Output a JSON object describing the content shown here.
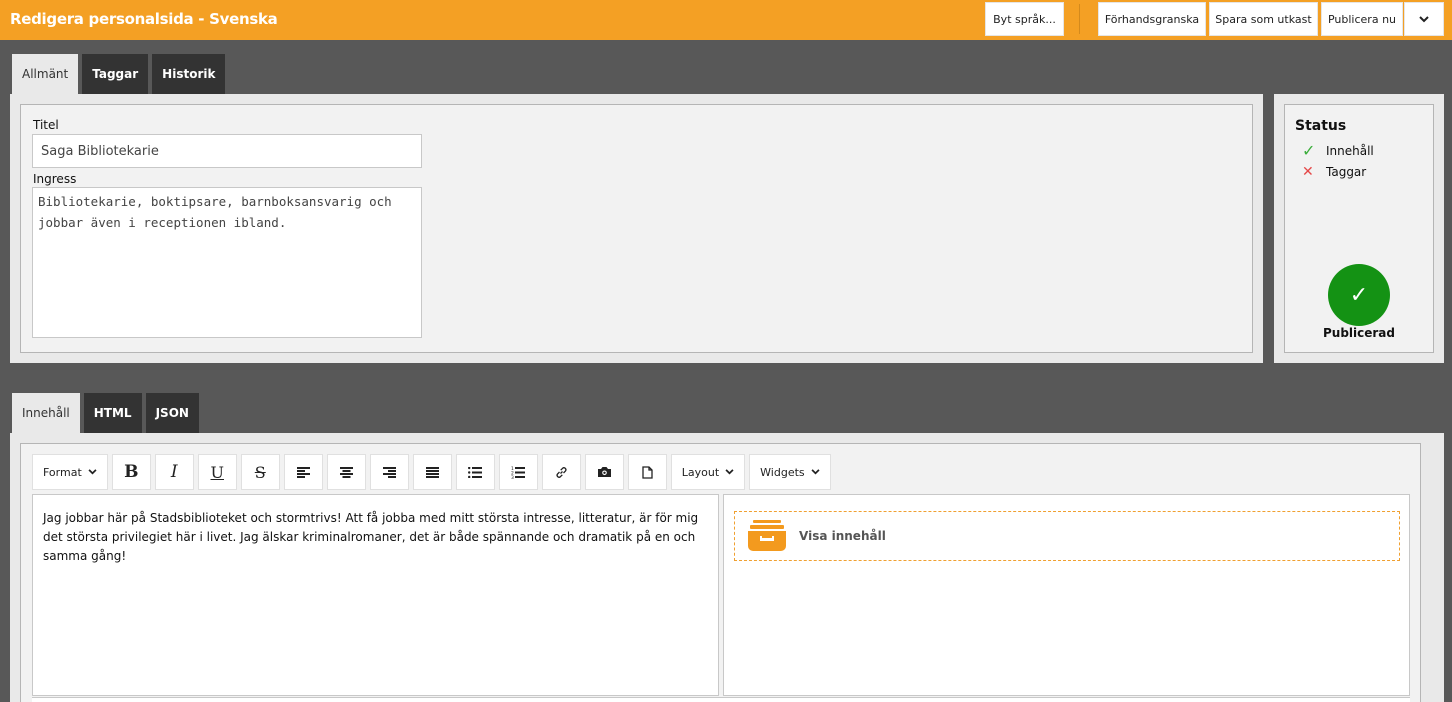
{
  "header": {
    "title": "Redigera personalsida - Svenska",
    "buttons": {
      "change_language": "Byt språk...",
      "preview": "Förhandsgranska",
      "save_draft": "Spara som utkast",
      "publish_now": "Publicera nu"
    },
    "accent_color": "#f4a024"
  },
  "top_tabs": [
    "Allmänt",
    "Taggar",
    "Historik"
  ],
  "form": {
    "title_label": "Titel",
    "title_value": "Saga Bibliotekarie",
    "intro_label": "Ingress",
    "intro_value": "Bibliotekarie, boktipsare, barnboksansvarig och\njobbar även i receptionen ibland."
  },
  "status": {
    "heading": "Status",
    "items": [
      {
        "label": "Innehåll",
        "ok": true
      },
      {
        "label": "Taggar",
        "ok": false
      }
    ],
    "published_label": "Publicerad"
  },
  "editor_tabs": [
    "Innehåll",
    "HTML",
    "JSON"
  ],
  "toolbar": {
    "format": "Format",
    "layout": "Layout",
    "widgets": "Widgets",
    "bold": "B",
    "italic": "I",
    "underline": "U",
    "strike": "S"
  },
  "editor": {
    "body_text": "Jag jobbar här på Stadsbiblioteket och stormtrivs! Att få jobba med mitt största intresse, litteratur, är för mig det största privilegiet här i livet. Jag älskar kriminalromaner, det är både spännande och dramatik på en och samma gång!",
    "widget_label": "Visa innehåll"
  }
}
